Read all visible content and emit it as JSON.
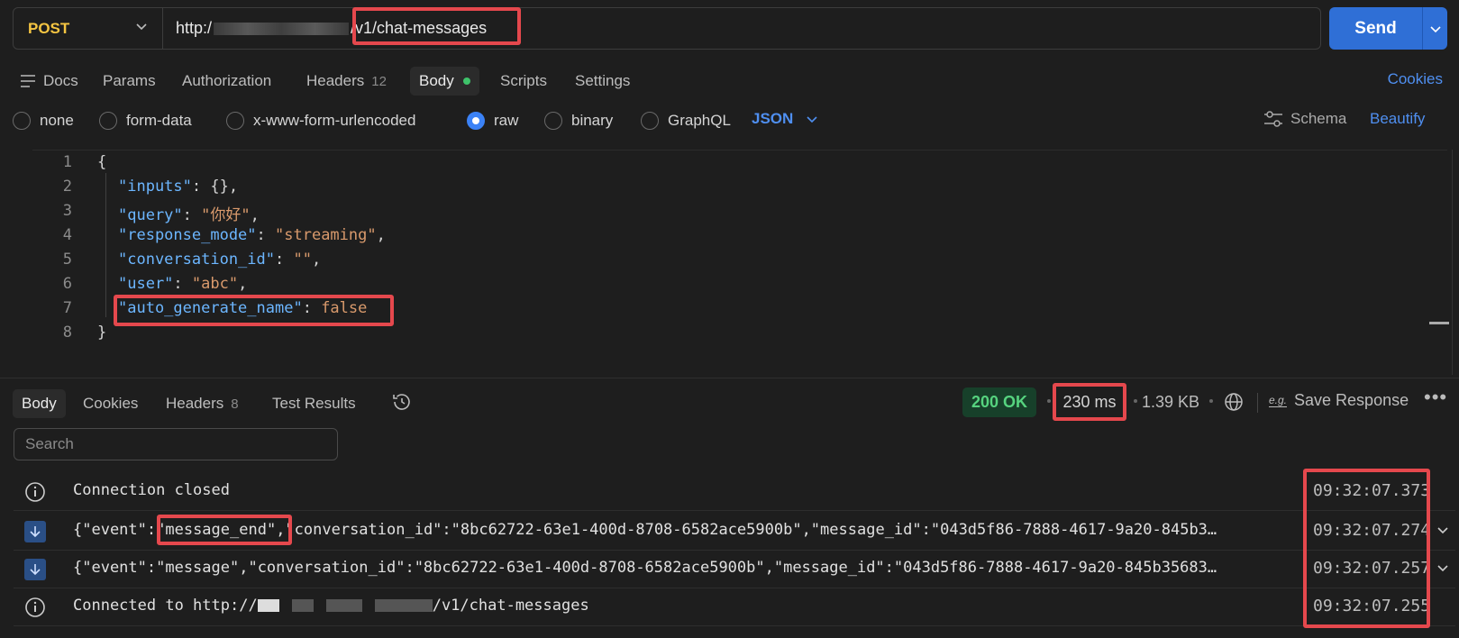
{
  "request": {
    "method": "POST",
    "url_prefix": "http:/",
    "url_path": "/v1/chat-messages",
    "send_label": "Send"
  },
  "request_tabs": {
    "docs": "Docs",
    "params": "Params",
    "authorization": "Authorization",
    "headers": "Headers",
    "headers_count": "12",
    "body": "Body",
    "scripts": "Scripts",
    "settings": "Settings",
    "cookies": "Cookies"
  },
  "body_types": {
    "none": "none",
    "form_data": "form-data",
    "urlencoded": "x-www-form-urlencoded",
    "raw": "raw",
    "binary": "binary",
    "graphql": "GraphQL",
    "format": "JSON",
    "selected": "raw",
    "schema": "Schema",
    "beautify": "Beautify"
  },
  "editor": {
    "line_numbers": [
      "1",
      "2",
      "3",
      "4",
      "5",
      "6",
      "7",
      "8"
    ],
    "lines": {
      "l1": "{",
      "l2_key": "\"inputs\"",
      "l2_rest": ": {},",
      "l3_key": "\"query\"",
      "l3_val": "\"你好\"",
      "l4_key": "\"response_mode\"",
      "l4_val": "\"streaming\"",
      "l5_key": "\"conversation_id\"",
      "l5_val": "\"\"",
      "l6_key": "\"user\"",
      "l6_val": "\"abc\"",
      "l7_key": "\"auto_generate_name\"",
      "l7_val": "false",
      "l8": "}"
    }
  },
  "response": {
    "tabs": {
      "body": "Body",
      "cookies": "Cookies",
      "headers": "Headers",
      "headers_count": "8",
      "test_results": "Test Results"
    },
    "status": "200 OK",
    "time": "230 ms",
    "size": "1.39 KB",
    "save_response": "Save Response",
    "search_placeholder": "Search",
    "messages": [
      {
        "icon": "info-icon",
        "text": "Connection closed",
        "time": "09:32:07.373"
      },
      {
        "icon": "arrow-down-icon",
        "text_prefix": "{\"event\":",
        "event": "\"message_end\"",
        "text_suffix": ",\"conversation_id\":\"8bc62722-63e1-400d-8708-6582ace5900b\",\"message_id\":\"043d5f86-7888-4617-9a20-845b3…",
        "time": "09:32:07.274"
      },
      {
        "icon": "arrow-down-icon",
        "text": "{\"event\":\"message\",\"conversation_id\":\"8bc62722-63e1-400d-8708-6582ace5900b\",\"message_id\":\"043d5f86-7888-4617-9a20-845b35683…",
        "time": "09:32:07.257"
      },
      {
        "icon": "info-icon",
        "text_prefix": "Connected to http://",
        "text_suffix": "/v1/chat-messages",
        "time": "09:32:07.255"
      }
    ]
  },
  "colors": {
    "accent": "#2f6fd6",
    "method": "#f5c542",
    "status_ok": "#56d37f",
    "highlight": "#e5484d"
  }
}
